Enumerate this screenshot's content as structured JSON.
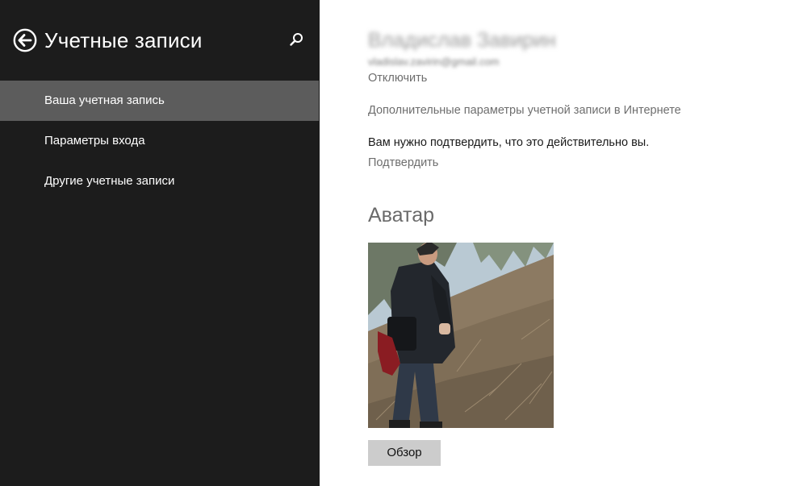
{
  "sidebar": {
    "title": "Учетные записи",
    "back_icon": "back-arrow-circle-icon",
    "search_icon": "search-icon",
    "items": [
      {
        "label": "Ваша учетная запись",
        "active": true
      },
      {
        "label": "Параметры входа",
        "active": false
      },
      {
        "label": "Другие учетные записи",
        "active": false
      }
    ]
  },
  "account": {
    "name": "Владислав Завирин",
    "email": "vladislav.zavirin@gmail.com",
    "disconnect_link": "Отключить",
    "more_settings_link": "Дополнительные параметры учетной записи в Интернете",
    "verify_message": "Вам нужно подтвердить, что это действительно вы.",
    "verify_link": "Подтвердить"
  },
  "avatar": {
    "section_title": "Аватар",
    "browse_button": "Обзор"
  },
  "colors": {
    "sidebar_bg": "#1c1c1c",
    "active_item_bg": "#5c5c5c",
    "content_bg": "#ffffff",
    "link_text": "#6e6e6e",
    "button_bg": "#cccccc"
  }
}
